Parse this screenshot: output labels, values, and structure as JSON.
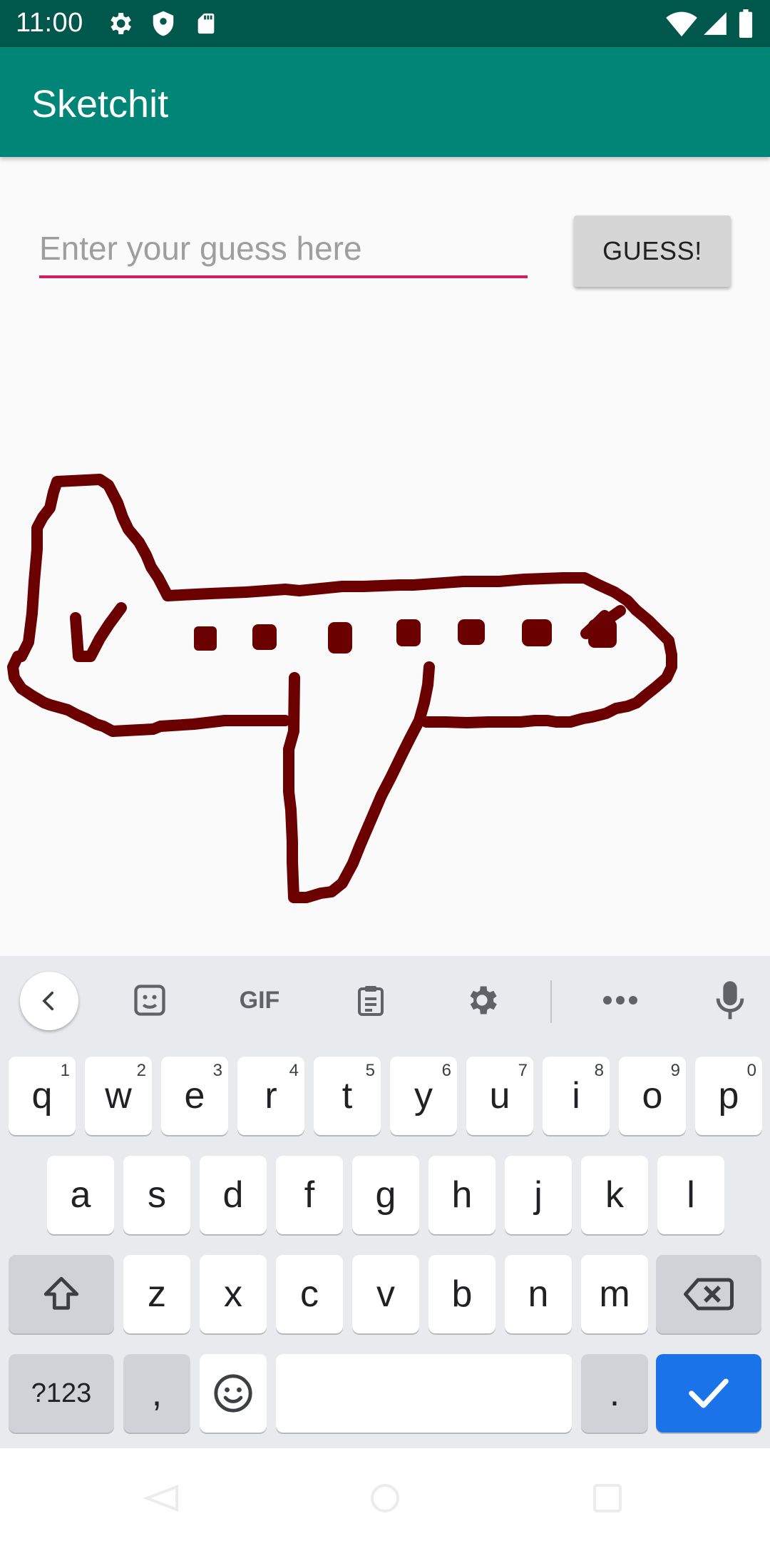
{
  "status_bar": {
    "time": "11:00",
    "icons": [
      "settings-icon",
      "shield-icon",
      "sd-card-icon",
      "wifi-icon",
      "signal-icon",
      "battery-icon"
    ]
  },
  "app_bar": {
    "title": "Sketchit"
  },
  "guess": {
    "placeholder": "Enter your guess here",
    "button_label": "GUESS!"
  },
  "canvas": {
    "stroke_color": "#6b0000"
  },
  "keyboard": {
    "toolbar": [
      "back-icon",
      "sticker-icon",
      "gif-icon",
      "clipboard-icon",
      "settings-icon",
      "more-icon",
      "microphone-icon"
    ],
    "gif_label": "GIF",
    "row1": [
      {
        "key": "q",
        "hint": "1"
      },
      {
        "key": "w",
        "hint": "2"
      },
      {
        "key": "e",
        "hint": "3"
      },
      {
        "key": "r",
        "hint": "4"
      },
      {
        "key": "t",
        "hint": "5"
      },
      {
        "key": "y",
        "hint": "6"
      },
      {
        "key": "u",
        "hint": "7"
      },
      {
        "key": "i",
        "hint": "8"
      },
      {
        "key": "o",
        "hint": "9"
      },
      {
        "key": "p",
        "hint": "0"
      }
    ],
    "row2": [
      "a",
      "s",
      "d",
      "f",
      "g",
      "h",
      "j",
      "k",
      "l"
    ],
    "row3": [
      "z",
      "x",
      "c",
      "v",
      "b",
      "n",
      "m"
    ],
    "symbols_label": "?123",
    "comma_label": ",",
    "period_label": "."
  },
  "colors": {
    "status_bar": "#00574b",
    "app_bar": "#008577",
    "accent": "#d81b60",
    "enter_key": "#1a73e8"
  }
}
